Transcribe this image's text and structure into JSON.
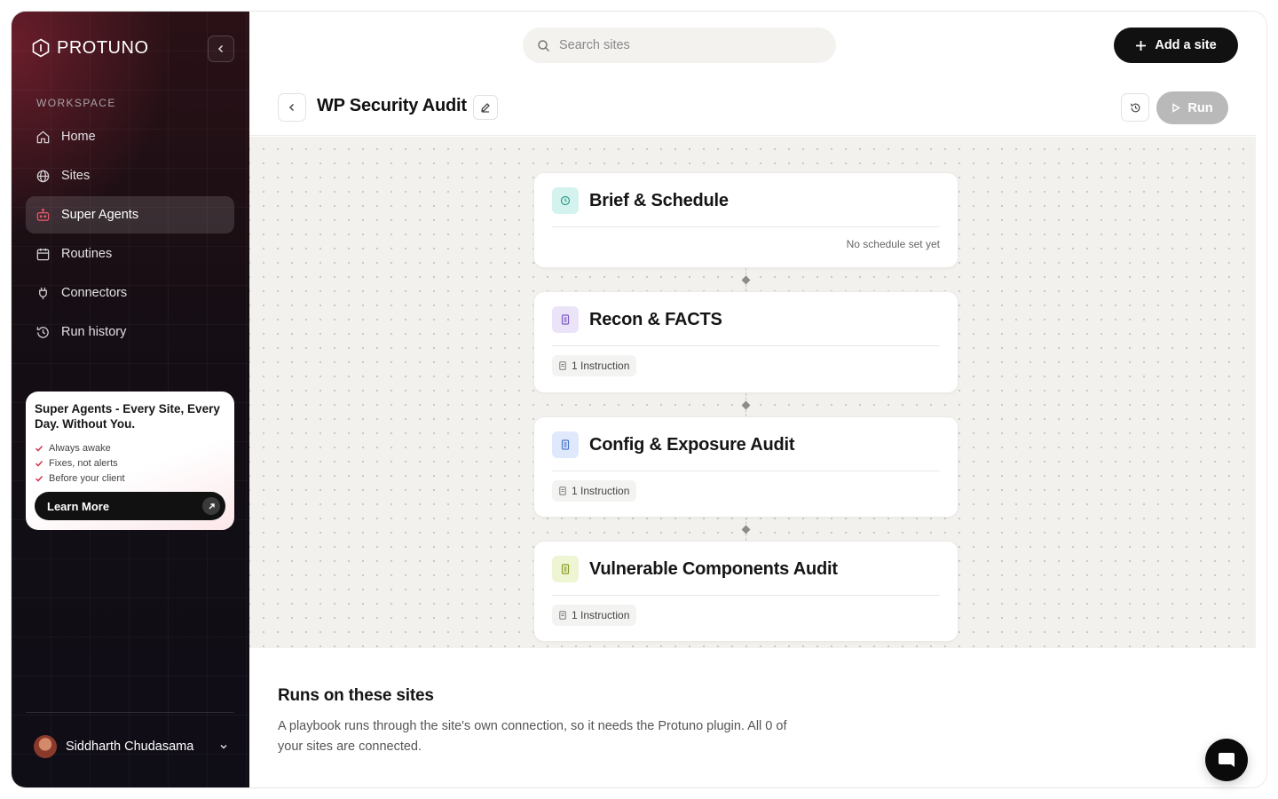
{
  "app": {
    "brand": "PROTUNO"
  },
  "sidebar": {
    "section_label": "WORKSPACE",
    "items": [
      {
        "label": "Home",
        "icon": "home-icon",
        "active": false
      },
      {
        "label": "Sites",
        "icon": "globe-icon",
        "active": false
      },
      {
        "label": "Super Agents",
        "icon": "robot-icon",
        "active": true
      },
      {
        "label": "Routines",
        "icon": "calendar-icon",
        "active": false
      },
      {
        "label": "Connectors",
        "icon": "plug-icon",
        "active": false
      },
      {
        "label": "Run history",
        "icon": "history-icon",
        "active": false
      }
    ],
    "promo": {
      "title": "Super Agents - Every Site, Every Day. Without You.",
      "points": [
        "Always awake",
        "Fixes, not alerts",
        "Before your client"
      ],
      "cta": "Learn More"
    },
    "user": {
      "name": "Siddharth Chudasama"
    }
  },
  "header": {
    "search_placeholder": "Search sites",
    "add_site_label": "Add a site"
  },
  "page": {
    "title": "WP Security Audit",
    "run_label": "Run"
  },
  "steps": [
    {
      "title": "Brief & Schedule",
      "meta": "No schedule set yet",
      "icon": "clock-icon",
      "icon_bg": "#d5f3ee",
      "icon_color": "#2a9c8a"
    },
    {
      "title": "Recon & FACTS",
      "chip": "1 Instruction",
      "icon": "document-icon",
      "icon_bg": "#ebe3f8",
      "icon_color": "#7b5cc4"
    },
    {
      "title": "Config & Exposure Audit",
      "chip": "1 Instruction",
      "icon": "document-icon",
      "icon_bg": "#dfe9fb",
      "icon_color": "#4a74c9"
    },
    {
      "title": "Vulnerable Components Audit",
      "chip": "1 Instruction",
      "icon": "document-icon",
      "icon_bg": "#eef5d2",
      "icon_color": "#8a9a2a"
    }
  ],
  "runs_section": {
    "heading": "Runs on these sites",
    "description": "A playbook runs through the site's own connection, so it needs the Protuno plugin. All 0 of your sites are connected."
  },
  "colors": {
    "accent": "#111111",
    "promo_check": "#d0364e",
    "active_nav_icon": "#e0566a"
  }
}
